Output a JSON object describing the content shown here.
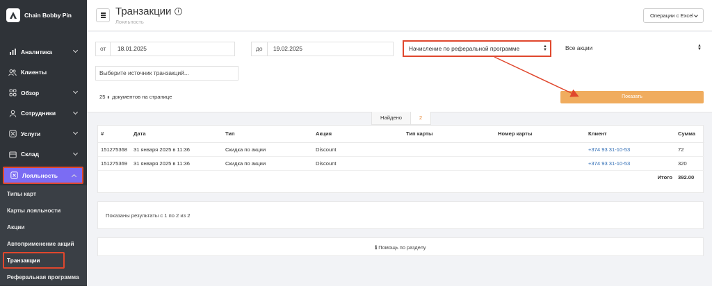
{
  "sidebar": {
    "brand": "Chain Bobby Pin",
    "items": [
      {
        "label": "Аналитика",
        "icon": "chart-bar-icon",
        "chevron": true
      },
      {
        "label": "Клиенты",
        "icon": "users-icon",
        "chevron": false
      },
      {
        "label": "Обзор",
        "icon": "grid-icon",
        "chevron": true
      },
      {
        "label": "Сотрудники",
        "icon": "user-icon",
        "chevron": true
      },
      {
        "label": "Услуги",
        "icon": "scissors-icon",
        "chevron": true
      },
      {
        "label": "Склад",
        "icon": "warehouse-icon",
        "chevron": true
      },
      {
        "label": "Лояльность",
        "icon": "loyalty-icon",
        "chevron": true
      }
    ],
    "submenu": [
      "Типы карт",
      "Карты лояльности",
      "Акции",
      "Автоприменение акций",
      "Транзакции",
      "Реферальная программа"
    ]
  },
  "header": {
    "title": "Транзакции",
    "subtitle": "Лояльность",
    "excel_label": "Операции с Excel"
  },
  "filters": {
    "from_label": "от",
    "from_value": "18.01.2025",
    "to_label": "до",
    "to_value": "19.02.2025",
    "type_value": "Начисление по реферальной программе",
    "promo_value": "Все акции",
    "source_placeholder": "Выберите источник транзакций...",
    "per_page_value": "25",
    "per_page_label": "документов на странице",
    "show_label": "Показать"
  },
  "found": {
    "label": "Найдено",
    "count": "2"
  },
  "table": {
    "headers": [
      "#",
      "Дата",
      "Тип",
      "Акция",
      "Тип карты",
      "Номер карты",
      "Клиент",
      "Сумма"
    ],
    "rows": [
      [
        "151275368",
        "31 января 2025 в 11:36",
        "Скидка по акции",
        "Discount",
        "",
        "",
        "+374 93 31-10-53",
        "72"
      ],
      [
        "151275369",
        "31 января 2025 в 11:36",
        "Скидка по акции",
        "Discount",
        "",
        "",
        "+374 93 31-10-53",
        "320"
      ]
    ],
    "total_label": "Итого",
    "total_value": "392.00"
  },
  "results_text": "Показаны результаты с 1 по 2 из 2",
  "help_text": "Помощь по разделу",
  "colors": {
    "accent": "#7b6cf3",
    "show_button": "#f0ac5e",
    "highlight": "#e0472d",
    "link": "#2d6bb4"
  }
}
